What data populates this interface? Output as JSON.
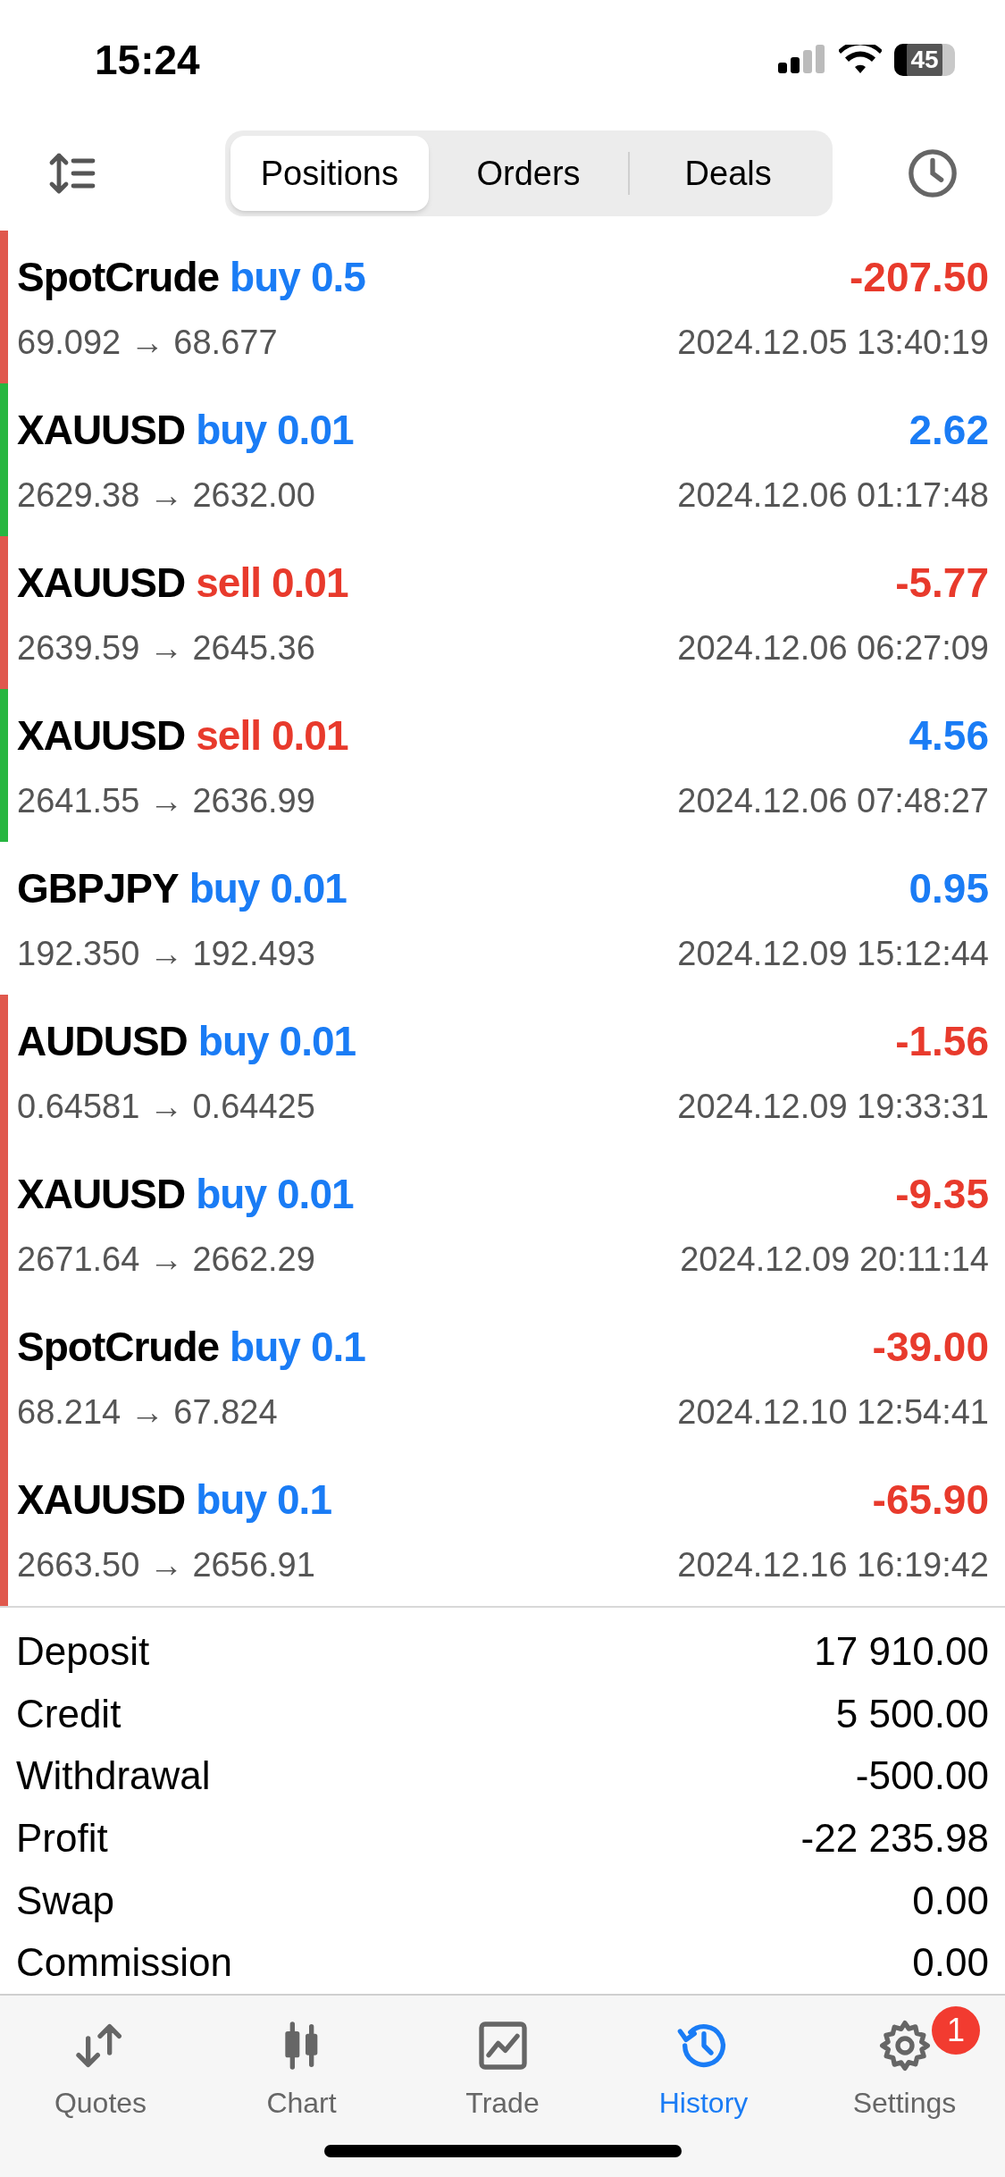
{
  "status_bar": {
    "time": "15:24",
    "battery": "45"
  },
  "tabs": [
    {
      "label": "Positions",
      "selected": true
    },
    {
      "label": "Orders",
      "selected": false
    },
    {
      "label": "Deals",
      "selected": false
    }
  ],
  "positions": [
    {
      "symbol": "SpotCrude",
      "side": "buy",
      "volume": "0.5",
      "prices": "69.092 → 68.677",
      "time": "2024.12.05 13:40:19",
      "profit": "-207.50",
      "color": "#e0584d"
    },
    {
      "symbol": "XAUUSD",
      "side": "buy",
      "volume": "0.01",
      "prices": "2629.38 → 2632.00",
      "time": "2024.12.06 01:17:48",
      "profit": "2.62",
      "color": "#27b640"
    },
    {
      "symbol": "XAUUSD",
      "side": "sell",
      "volume": "0.01",
      "prices": "2639.59 → 2645.36",
      "time": "2024.12.06 06:27:09",
      "profit": "-5.77",
      "color": "#e0584d"
    },
    {
      "symbol": "XAUUSD",
      "side": "sell",
      "volume": "0.01",
      "prices": "2641.55 → 2636.99",
      "time": "2024.12.06 07:48:27",
      "profit": "4.56",
      "color": "#27b640"
    },
    {
      "symbol": "GBPJPY",
      "side": "buy",
      "volume": "0.01",
      "prices": "192.350 → 192.493",
      "time": "2024.12.09 15:12:44",
      "profit": "0.95"
    },
    {
      "symbol": "AUDUSD",
      "side": "buy",
      "volume": "0.01",
      "prices": "0.64581 → 0.64425",
      "time": "2024.12.09 19:33:31",
      "profit": "-1.56",
      "color": "#e0584d"
    },
    {
      "symbol": "XAUUSD",
      "side": "buy",
      "volume": "0.01",
      "prices": "2671.64 → 2662.29",
      "time": "2024.12.09 20:11:14",
      "profit": "-9.35",
      "color": "#e0584d"
    },
    {
      "symbol": "SpotCrude",
      "side": "buy",
      "volume": "0.1",
      "prices": "68.214 → 67.824",
      "time": "2024.12.10 12:54:41",
      "profit": "-39.00",
      "color": "#e0584d"
    },
    {
      "symbol": "XAUUSD",
      "side": "buy",
      "volume": "0.1",
      "prices": "2663.50 → 2656.91",
      "time": "2024.12.16 16:19:42",
      "profit": "-65.90",
      "color": "#e0584d"
    }
  ],
  "summary": [
    {
      "label": "Deposit",
      "value": "17 910.00"
    },
    {
      "label": "Credit",
      "value": "5 500.00"
    },
    {
      "label": "Withdrawal",
      "value": "-500.00"
    },
    {
      "label": "Profit",
      "value": "-22 235.98"
    },
    {
      "label": "Swap",
      "value": "0.00"
    },
    {
      "label": "Commission",
      "value": "0.00"
    }
  ],
  "nav": [
    {
      "label": "Quotes",
      "kind": "quotes",
      "selected": false
    },
    {
      "label": "Chart",
      "kind": "chart",
      "selected": false
    },
    {
      "label": "Trade",
      "kind": "trade",
      "selected": false
    },
    {
      "label": "History",
      "kind": "history",
      "selected": true
    },
    {
      "label": "Settings",
      "kind": "settings",
      "selected": false,
      "badge": "1"
    }
  ]
}
